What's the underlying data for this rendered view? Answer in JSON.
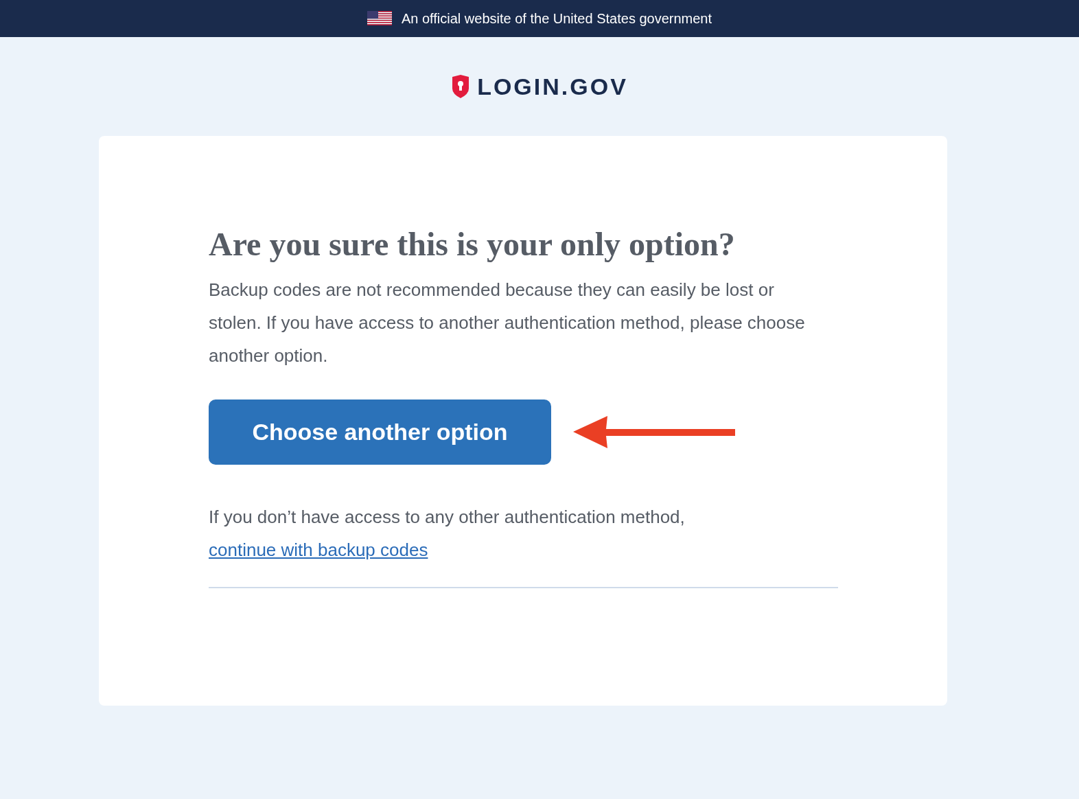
{
  "banner": {
    "text": "An official website of the United States government"
  },
  "logo": {
    "text": "LOGIN.GOV"
  },
  "card": {
    "heading": "Are you sure this is your only option?",
    "description": "Backup codes are not recommended because they can easily be lost or stolen. If you have access to another authentication method, please choose another option.",
    "primary_button": "Choose another option",
    "fallback_text": "If you don’t have access to any other authentication method,",
    "fallback_link": "continue with backup codes"
  }
}
